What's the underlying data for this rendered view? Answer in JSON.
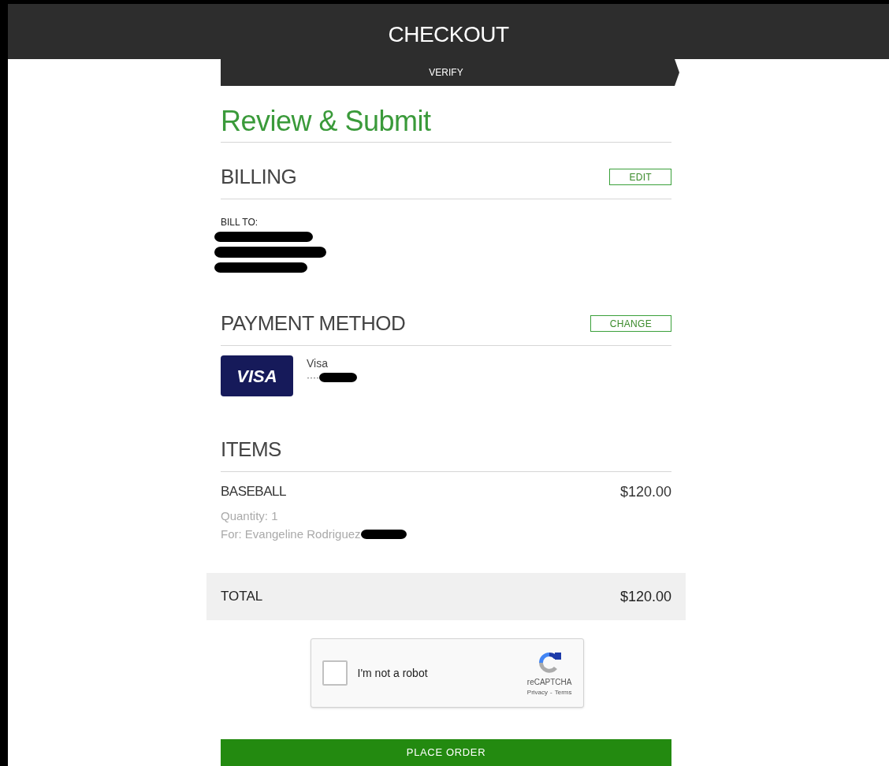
{
  "header": {
    "title": "CHECKOUT"
  },
  "step": {
    "label": "VERIFY"
  },
  "page_title": "Review & Submit",
  "billing": {
    "heading": "BILLING",
    "action": "EDIT",
    "label": "BILL TO:"
  },
  "payment": {
    "heading": "PAYMENT METHOD",
    "action": "CHANGE",
    "card_logo": "VISA",
    "card_name": "Visa",
    "card_number": "····"
  },
  "items": {
    "heading": "ITEMS",
    "rows": [
      {
        "name": "BASEBALL",
        "price": "$120.00",
        "quantity": "Quantity: 1",
        "for": "For: Evangeline Rodriguez"
      }
    ]
  },
  "total": {
    "label": "TOTAL",
    "amount": "$120.00"
  },
  "captcha": {
    "label": "I'm not a robot",
    "checked": false,
    "brand": "reCAPTCHA",
    "links": [
      "Privacy",
      "Terms"
    ],
    "separator": "-"
  },
  "place_order": "PLACE ORDER"
}
